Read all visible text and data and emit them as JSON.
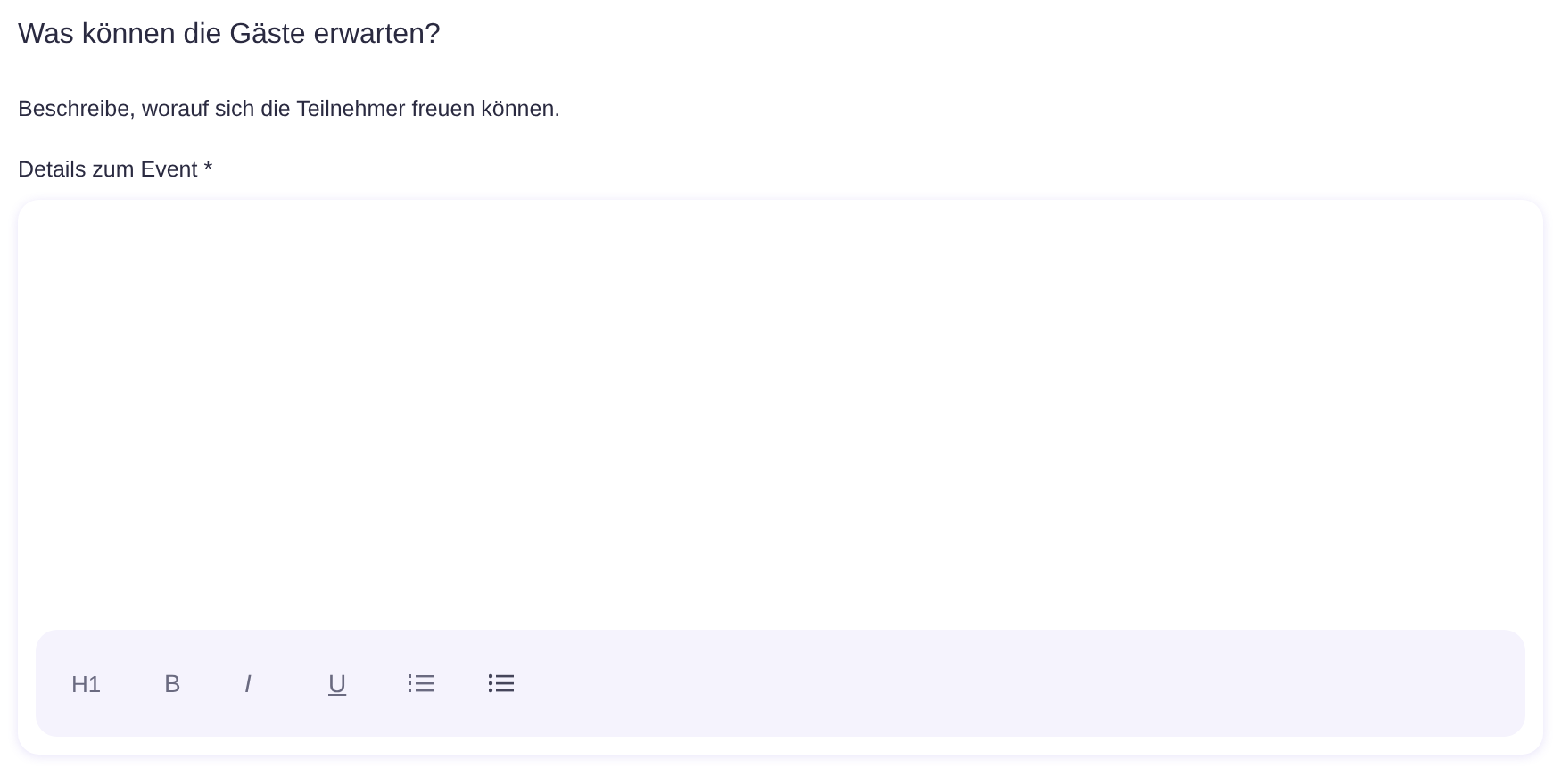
{
  "heading": "Was können die Gäste erwarten?",
  "description": "Beschreibe, worauf sich die Teilnehmer freuen können.",
  "field": {
    "label": "Details zum Event *"
  },
  "toolbar": [
    {
      "kind": "heading",
      "label": "H1"
    },
    {
      "kind": "bold",
      "label": "B"
    },
    {
      "kind": "italic",
      "label": "I"
    },
    {
      "kind": "underline",
      "label": "U"
    },
    {
      "kind": "ordered-list"
    },
    {
      "kind": "bullet-list"
    }
  ]
}
